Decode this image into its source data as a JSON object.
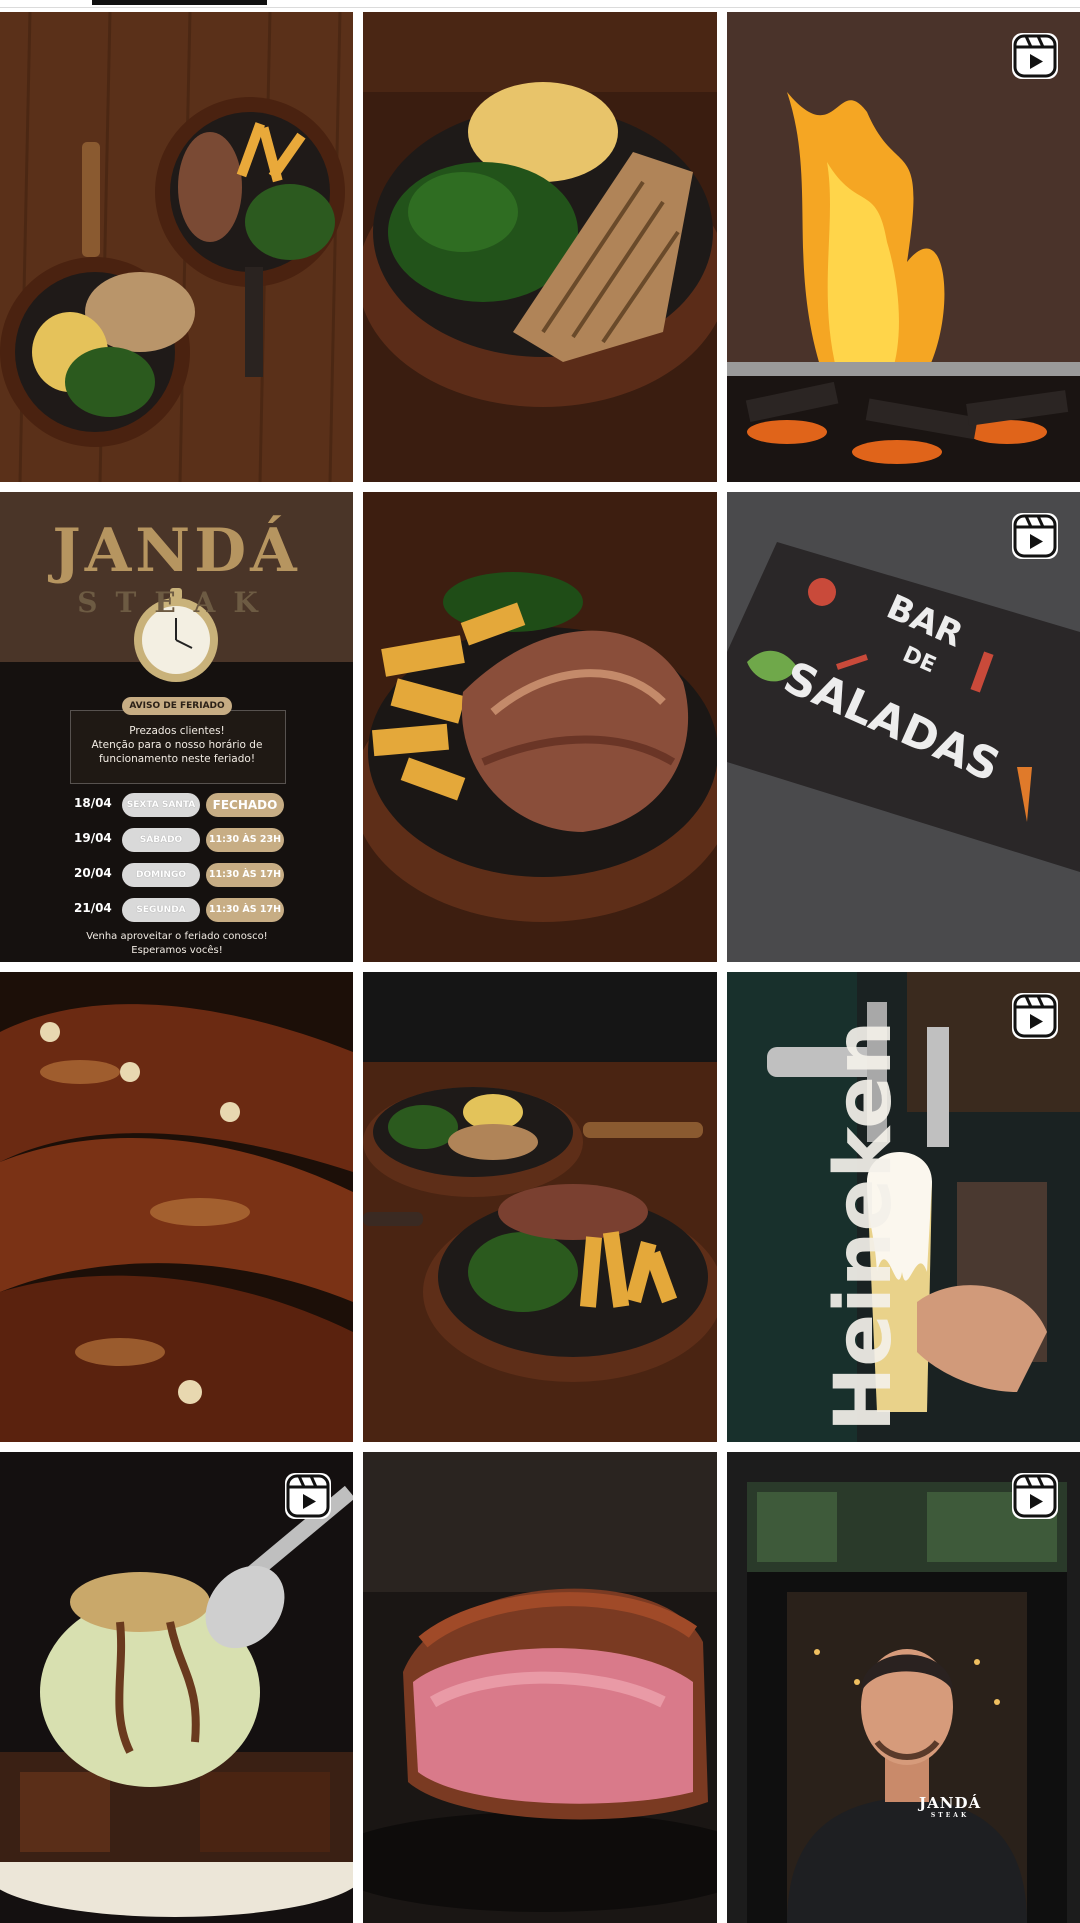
{
  "profile_tabs": {
    "active_index": 0
  },
  "grid": {
    "tiles": [
      {
        "name": "steak-fries-two-pans",
        "is_reel": false
      },
      {
        "name": "grilled-fish-greens",
        "is_reel": false
      },
      {
        "name": "wood-fire-grill",
        "is_reel": true
      },
      {
        "name": "holiday-hours-notice",
        "is_reel": false
      },
      {
        "name": "beef-fries-skillet",
        "is_reel": false
      },
      {
        "name": "salad-bar-sign",
        "is_reel": true
      },
      {
        "name": "grilled-ribs-closeup",
        "is_reel": false
      },
      {
        "name": "two-skillets-table",
        "is_reel": false
      },
      {
        "name": "draft-beer-tap",
        "is_reel": true
      },
      {
        "name": "ice-cream-brownie",
        "is_reel": true
      },
      {
        "name": "rare-steak-closeup",
        "is_reel": false
      },
      {
        "name": "owner-video",
        "is_reel": true
      }
    ]
  },
  "holiday_notice": {
    "logo": "JANDÁ",
    "logo_sub": "STEAK",
    "title": "AVISO DE FERIADO",
    "message_line1": "Prezados clientes!",
    "message_line2": "Atenção para o nosso horário de",
    "message_line3": "funcionamento neste feriado!",
    "rows": [
      {
        "date": "18/04",
        "day": "SEXTA SANTA",
        "hours": "FECHADO"
      },
      {
        "date": "19/04",
        "day": "SÁBADO",
        "hours": "11:30 ÀS 23H"
      },
      {
        "date": "20/04",
        "day": "DOMINGO",
        "hours": "11:30 ÀS 17H"
      },
      {
        "date": "21/04",
        "day": "SEGUNDA",
        "hours": "11:30 ÀS 17H"
      }
    ],
    "footer_line1": "Venha aproveitar o feriado conosco!",
    "footer_line2": "Esperamos vocês!"
  },
  "salad_sign": {
    "line1": "BAR",
    "line2": "DE",
    "line3": "SALADAS"
  },
  "beer": {
    "brand": "Heineken"
  },
  "shirt": {
    "logo": "JANDÁ",
    "sub": "STEAK"
  },
  "colors": {
    "gold": "#c7ad84",
    "wood": "#6b3a22",
    "tab_indicator": "#111111",
    "divider": "#dbdbdb"
  }
}
